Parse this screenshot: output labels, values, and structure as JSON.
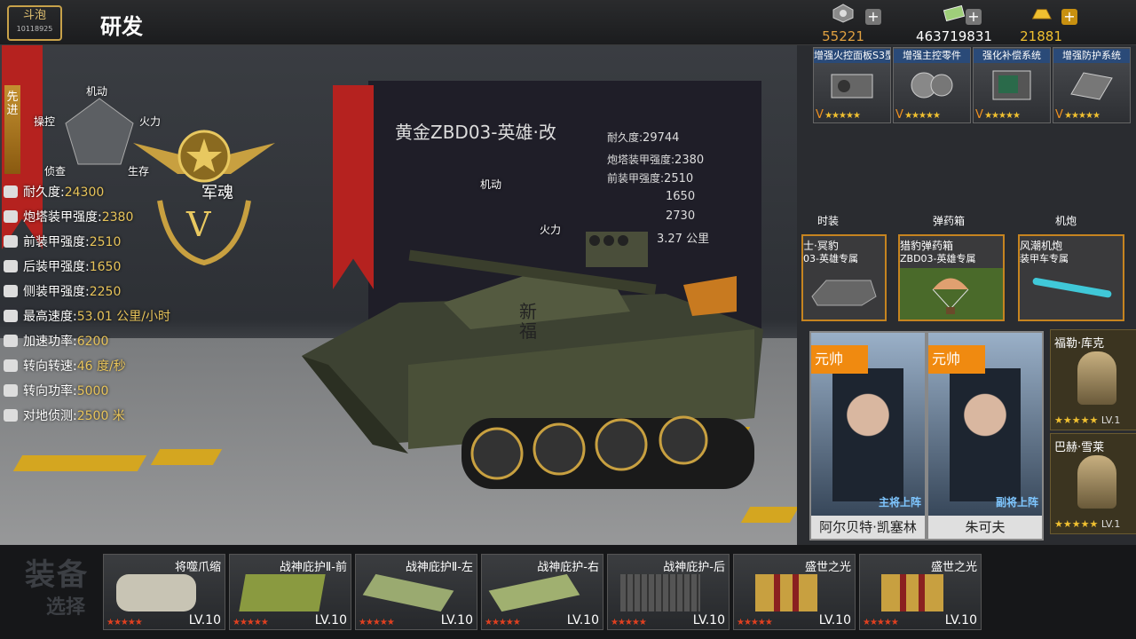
{
  "header": {
    "logo_text": "斗泡",
    "logo_sub": "10118925",
    "title": "研发"
  },
  "resources": [
    {
      "icon": "medal-icon",
      "value": "55221",
      "color": "#e0a040"
    },
    {
      "icon": "cash-icon",
      "value": "463719831",
      "color": "#ffffff"
    },
    {
      "icon": "gold-bar-icon",
      "value": "21881",
      "color": "#f0c030"
    }
  ],
  "left_panel": {
    "rank_text": "先进",
    "radar_labels": [
      "机动",
      "操控",
      "火力",
      "侦查",
      "生存"
    ],
    "emblem_text": "军魂",
    "stats": [
      {
        "label": "耐久度:",
        "value": "24300"
      },
      {
        "label": "炮塔装甲强度:",
        "value": "2380"
      },
      {
        "label": "前装甲强度:",
        "value": "2510"
      },
      {
        "label": "后装甲强度:",
        "value": "1650"
      },
      {
        "label": "侧装甲强度:",
        "value": "2250"
      },
      {
        "label": "最高速度:",
        "value": "53.01 公里/小时"
      },
      {
        "label": "加速功率:",
        "value": "6200"
      },
      {
        "label": "转向转速:",
        "value": "46 度/秒"
      },
      {
        "label": "转向功率:",
        "value": "5000"
      },
      {
        "label": "对地侦测:",
        "value": "2500 米"
      }
    ]
  },
  "vehicle": {
    "name": "黄金ZBD03-英雄·改",
    "radar_labels": [
      "机动",
      "火力"
    ],
    "stats": [
      {
        "label": "耐久度:",
        "value": "29744"
      },
      {
        "label": "炮塔装甲强度:",
        "value": "2380"
      },
      {
        "label": "前装甲强度:",
        "value": "2510"
      },
      {
        "label": "",
        "value": "1650"
      },
      {
        "label": "",
        "value": "2730"
      },
      {
        "label": "",
        "value": "3.27 公里"
      }
    ],
    "side_text": "新福"
  },
  "modules": [
    {
      "label": "增强火控面板S3型",
      "grade": "V",
      "stars": "★★★★★"
    },
    {
      "label": "增强主控零件",
      "grade": "V",
      "stars": "★★★★★"
    },
    {
      "label": "强化补偿系统",
      "grade": "V",
      "stars": "★★★★★"
    },
    {
      "label": "增强防护系统",
      "grade": "V",
      "stars": "★★★★★"
    }
  ],
  "categories": [
    "时装",
    "弹药箱",
    "机炮"
  ],
  "equipment": [
    {
      "line1": "士·冥豹",
      "line2": "03-英雄专属"
    },
    {
      "line1": "猎豹弹药箱",
      "line2": "ZBD03-英雄专属"
    },
    {
      "line1": "风潮机炮",
      "line2": "装甲车专属"
    }
  ],
  "generals": [
    {
      "rank": "元帅",
      "name": "阿尔贝特·凯塞林",
      "role": "主将上阵"
    },
    {
      "rank": "元帅",
      "name": "朱可夫",
      "role": "副将上阵"
    }
  ],
  "side_generals": [
    {
      "name": "福勒·库克",
      "stars": "★★★★★",
      "level": "LV.1"
    },
    {
      "name": "巴赫·雪莱",
      "stars": "★★★★★",
      "level": "LV.1"
    }
  ],
  "bottom": {
    "equip_label": "装备",
    "select_label": "选择",
    "parts": [
      {
        "name": "将噬爪缩",
        "stars": "★★★★★",
        "level": "LV.10",
        "color": "#c8c4b4"
      },
      {
        "name": "战神庇护Ⅱ-前",
        "stars": "★★★★★",
        "level": "LV.10",
        "color": "#8a9a40"
      },
      {
        "name": "战神庇护Ⅱ-左",
        "stars": "★★★★★",
        "level": "LV.10",
        "color": "#9aaa70"
      },
      {
        "name": "战神庇护-右",
        "stars": "★★★★★",
        "level": "LV.10",
        "color": "#a0b070"
      },
      {
        "name": "战神庇护-后",
        "stars": "★★★★★",
        "level": "LV.10",
        "color": "#555555"
      },
      {
        "name": "盛世之光",
        "stars": "★★★★★",
        "level": "LV.10",
        "color": "#c8a040"
      },
      {
        "name": "盛世之光",
        "stars": "★★★★★",
        "level": "LV.10",
        "color": "#c8a040"
      }
    ]
  }
}
